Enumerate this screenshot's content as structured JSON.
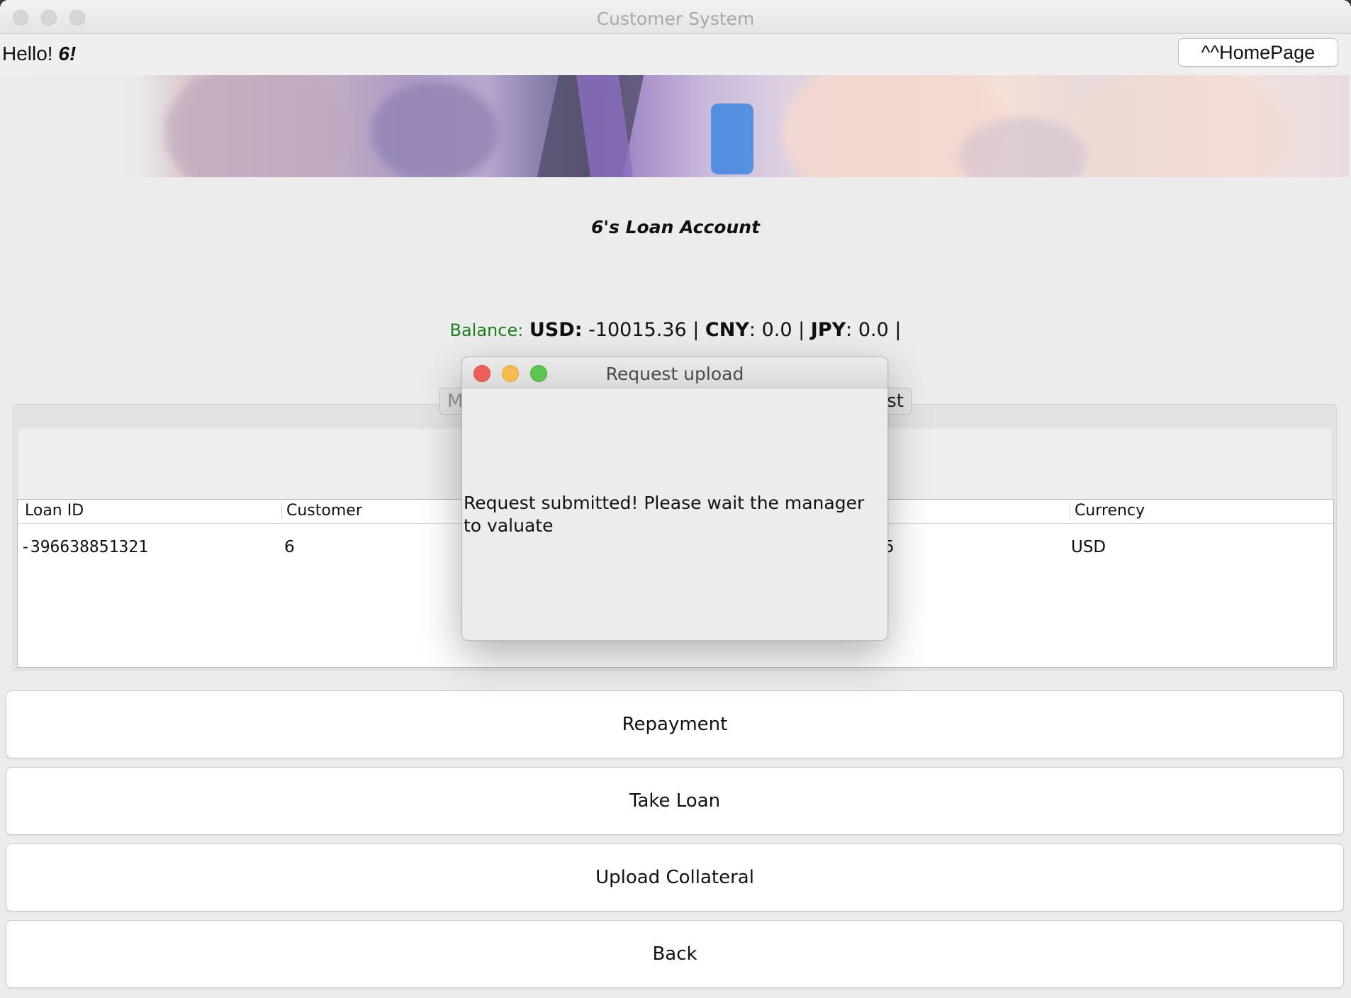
{
  "window": {
    "title": "Customer System"
  },
  "header": {
    "greeting_prefix": "Hello! ",
    "username": "6!",
    "home_button": "^^HomePage"
  },
  "account": {
    "title": "6's Loan Account",
    "balance_label": "Balance:",
    "usd_label": "USD:",
    "usd_value": " -10015.36 | ",
    "cny_label": "CNY",
    "cny_value": ": 0.0 | ",
    "jpy_label": "JPY",
    "jpy_value": ": 0.0 |"
  },
  "tabs": {
    "left_partial": "M",
    "right_partial": "st"
  },
  "table": {
    "columns": [
      "Loan ID",
      "Customer",
      "Currency"
    ],
    "rows": [
      {
        "loan_id": "-396638851321",
        "customer": "6",
        "hidden_partial": "5",
        "currency": "USD"
      }
    ]
  },
  "buttons": {
    "repayment": "Repayment",
    "take_loan": "Take Loan",
    "upload_collateral": "Upload Collateral",
    "back": "Back"
  },
  "dialog": {
    "title": "Request upload",
    "message": "Request submitted! Please wait the manager to valuate"
  },
  "colors": {
    "balance_label": "#1a7f1a",
    "close": "#ee5f57",
    "minimize": "#f5bd4f",
    "maximize": "#5ec454"
  }
}
